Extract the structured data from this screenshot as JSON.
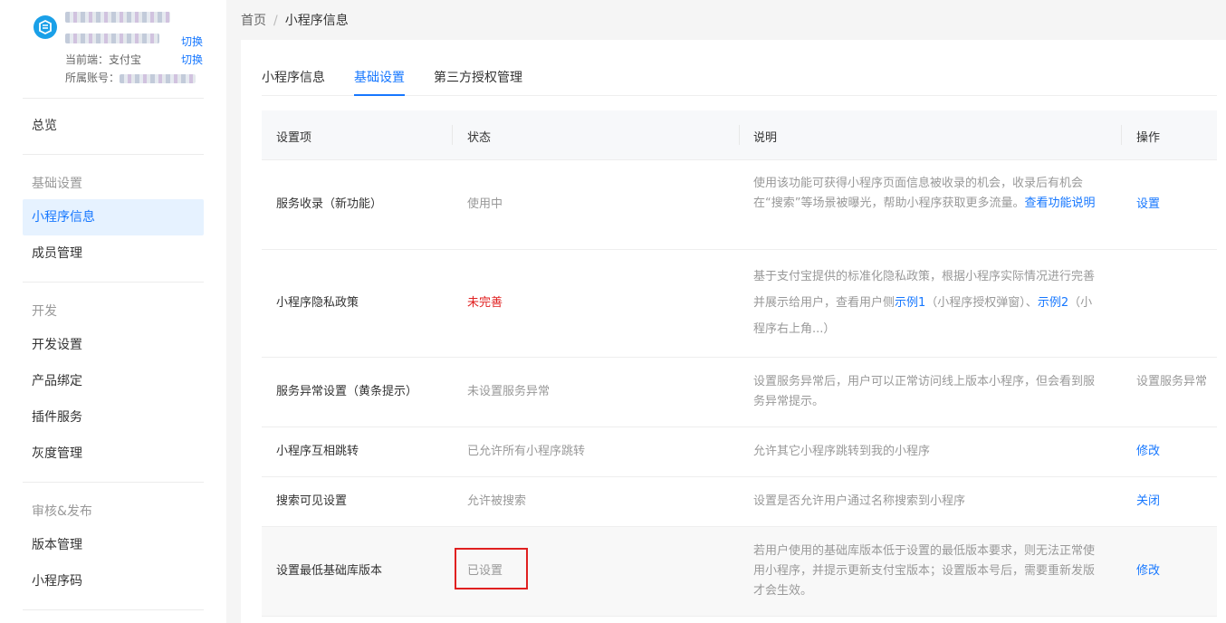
{
  "sidebar": {
    "switch_label_1": "切换",
    "switch_label_2": "切换",
    "current_end_label": "当前端：支付宝",
    "account_label": "所属账号：",
    "items": {
      "overview": "总览",
      "group_basic": "基础设置",
      "mini_info": "小程序信息",
      "members": "成员管理",
      "group_dev": "开发",
      "dev_settings": "开发设置",
      "product_binding": "产品绑定",
      "plugin_service": "插件服务",
      "gray_management": "灰度管理",
      "group_review": "审核&发布",
      "version_management": "版本管理",
      "mini_code": "小程序码"
    }
  },
  "breadcrumb": {
    "home": "首页",
    "separator": "/",
    "current": "小程序信息"
  },
  "tabs": {
    "info": "小程序信息",
    "basic": "基础设置",
    "third_party": "第三方授权管理"
  },
  "table": {
    "headers": {
      "item": "设置项",
      "status": "状态",
      "desc": "说明",
      "action": "操作"
    },
    "rows": [
      {
        "item": "服务收录（新功能）",
        "status": "使用中",
        "desc_text": "使用该功能可获得小程序页面信息被收录的机会，收录后有机会在“搜索”等场景被曝光，帮助小程序获取更多流量。",
        "desc_link": "查看功能说明",
        "action": "设置"
      },
      {
        "item": "小程序隐私政策",
        "status": "未完善",
        "desc_text": "基于支付宝提供的标准化隐私政策，根据小程序实际情况进行完善并展示给用户，查看用户侧",
        "desc_link1": "示例1",
        "desc_mid": "（小程序授权弹窗）、",
        "desc_link2": "示例2",
        "desc_tail": "（小程序右上角...）",
        "action": ""
      },
      {
        "item": "服务异常设置（黄条提示）",
        "status": "未设置服务异常",
        "desc": "设置服务异常后，用户可以正常访问线上版本小程序，但会看到服务异常提示。",
        "action": "设置服务异常"
      },
      {
        "item": "小程序互相跳转",
        "status": "已允许所有小程序跳转",
        "desc": "允许其它小程序跳转到我的小程序",
        "action": "修改"
      },
      {
        "item": "搜索可见设置",
        "status": "允许被搜索",
        "desc": "设置是否允许用户通过名称搜索到小程序",
        "action": "关闭"
      },
      {
        "item": "设置最低基础库版本",
        "status": "已设置",
        "desc": "若用户使用的基础库版本低于设置的最低版本要求，则无法正常使用小程序，并提示更新支付宝版本；设置版本号后，需要重新发版才会生效。",
        "action": "修改"
      }
    ]
  },
  "colors": {
    "accent": "#1677ff",
    "danger": "#e02020",
    "muted": "#999999"
  },
  "icons": {
    "app_logo": "app-logo-icon"
  }
}
